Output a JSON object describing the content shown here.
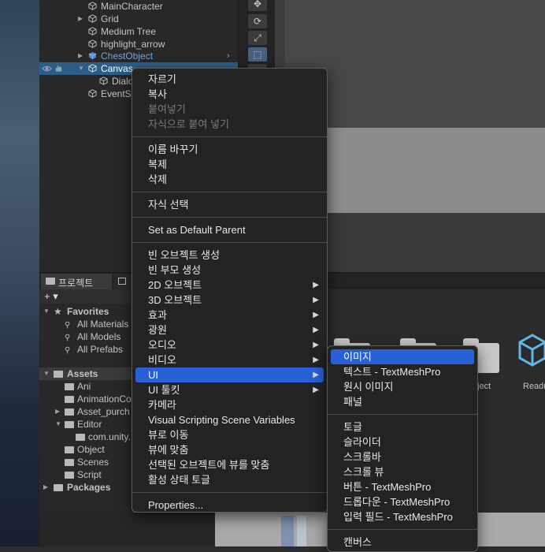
{
  "hierarchy": {
    "items": [
      {
        "label": "MainCharacter"
      },
      {
        "label": "Grid"
      },
      {
        "label": "Medium Tree"
      },
      {
        "label": "highlight_arrow"
      },
      {
        "label": "ChestObject"
      },
      {
        "label": "Canvas"
      },
      {
        "label": "Dialo"
      },
      {
        "label": "EventS"
      }
    ]
  },
  "tools": {
    "move": "✥",
    "rotate": "⟳",
    "scale": "⤢",
    "rect": "⬚",
    "transform": "◎"
  },
  "project": {
    "tab_label": "프로젝트",
    "add_label": "+ ▾",
    "search_glyph": "🔍",
    "favorites": {
      "header": "Favorites",
      "items": [
        "All Materials",
        "All Models",
        "All Prefabs"
      ]
    },
    "assets": {
      "header": "Assets",
      "items": [
        "Ani",
        "AnimationCo",
        "Asset_purch",
        "Editor",
        "com.unity.",
        "Object",
        "Scenes",
        "Script"
      ]
    },
    "packages": "Packages",
    "grid_labels": [
      "bject",
      "Readr"
    ]
  },
  "context_menu": {
    "groups": [
      [
        "자르기",
        "복사",
        "붙여넣기",
        "자식으로 붙여 넣기"
      ],
      [
        "이름 바꾸기",
        "복제",
        "삭제"
      ],
      [
        "자식 선택"
      ],
      [
        "Set as Default Parent"
      ],
      [
        "빈 오브젝트 생성",
        "빈 부모 생성",
        "2D 오브젝트",
        "3D 오브젝트",
        "효과",
        "광원",
        "오디오",
        "비디오",
        "UI",
        "UI 툴킷",
        "카메라",
        "Visual Scripting Scene Variables",
        "뷰로 이동",
        "뷰에 맞춤",
        "선택된 오브젝트에 뷰를 맞춤",
        "활성 상태 토글"
      ],
      [
        "Properties..."
      ]
    ]
  },
  "submenu": {
    "groups": [
      [
        "이미지",
        "텍스트 - TextMeshPro",
        "원시 이미지",
        "패널"
      ],
      [
        "토글",
        "슬라이더",
        "스크롤바",
        "스크롤 뷰",
        "버튼 - TextMeshPro",
        "드롭다운 - TextMeshPro",
        "입력 필드 - TextMeshPro"
      ],
      [
        "캔버스"
      ]
    ]
  },
  "arrow_glyph": "▶",
  "colors": {
    "highlight": "#2a60d6",
    "selected_row": "#2c5d87",
    "prefab_blue": "#6ea4e0"
  }
}
